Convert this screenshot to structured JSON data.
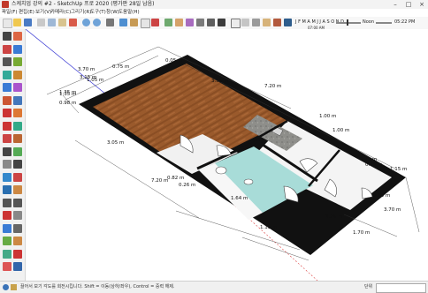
{
  "window": {
    "title": "스케치업 강의 #2 - SketchUp 프로 2020 (평가판 28일 남음)"
  },
  "menu": [
    "파일(F)",
    "편집(E)",
    "보기(V)",
    "카메라(C)",
    "그리기(R)",
    "도구(T)",
    "창(W)",
    "도움말(H)"
  ],
  "shadow": {
    "time_start": "07:00 AM",
    "noon": "Noon",
    "time_end": "05:22 PM",
    "months": "J F M A M J J A S O N D"
  },
  "dimensions": {
    "top_left_a": "3.70 m",
    "top_left_b": "1.35 m",
    "top_left_c": "0.75 m",
    "top_wall": "0.05 m",
    "left_a": "3.15 m",
    "left_b": "1.05 m",
    "left_c": "1.35 m",
    "left_d": "0.98 m",
    "top_mid": "3.55 m",
    "top_right": "7.20 m",
    "right_a": "1.00 m",
    "right_b": "1.00 m",
    "right_c": "0.71 m",
    "right_d": "0.75 m",
    "right_e": "1.15 m",
    "right_f": "0.85 m",
    "right_g": "3.70 m",
    "right_h": "1.25 m",
    "right_i": "1.70 m",
    "left_outer": "3.05 m",
    "bottom_long": "7.20 m",
    "bottom_b": "0.82 m",
    "bottom_c": "0.26 m",
    "bottom_d": "1.64 m",
    "bottom_e": "1.15 m"
  },
  "status": {
    "hint": "끌어서 보기 각도를 회전시킵니다. Shift = 이동(상하/좌우), Control = 중력 해제.",
    "measure_label": "단위"
  }
}
